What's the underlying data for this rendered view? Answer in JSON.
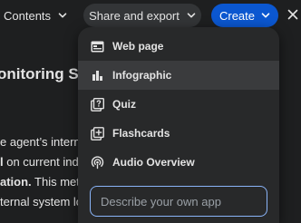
{
  "topbar": {
    "contents_label": "Contents",
    "share_label": "Share and export",
    "create_label": "Create"
  },
  "document": {
    "heading": "onitoring Sy",
    "lines": [
      {
        "pre": "e agent’s intern",
        "bold": "",
        "post": ""
      },
      {
        "pre": "",
        "bold": "l",
        "post": " on current ind"
      },
      {
        "pre": "",
        "bold": "ation.",
        "post": " This meth"
      },
      {
        "pre": "ternal system lo",
        "bold": "",
        "post": ""
      }
    ]
  },
  "menu": {
    "items": [
      {
        "label": "Web page",
        "icon": "web-page-icon"
      },
      {
        "label": "Infographic",
        "icon": "bar-chart-icon"
      },
      {
        "label": "Quiz",
        "icon": "quiz-icon"
      },
      {
        "label": "Flashcards",
        "icon": "flashcards-icon"
      },
      {
        "label": "Audio Overview",
        "icon": "podcast-icon"
      }
    ],
    "active_item": "Infographic",
    "input_placeholder": "Describe your own app"
  },
  "colors": {
    "background": "#1e1f20",
    "menu_background": "#28292a",
    "accent": "#0b57d0",
    "input_border": "#8ab4f8"
  }
}
